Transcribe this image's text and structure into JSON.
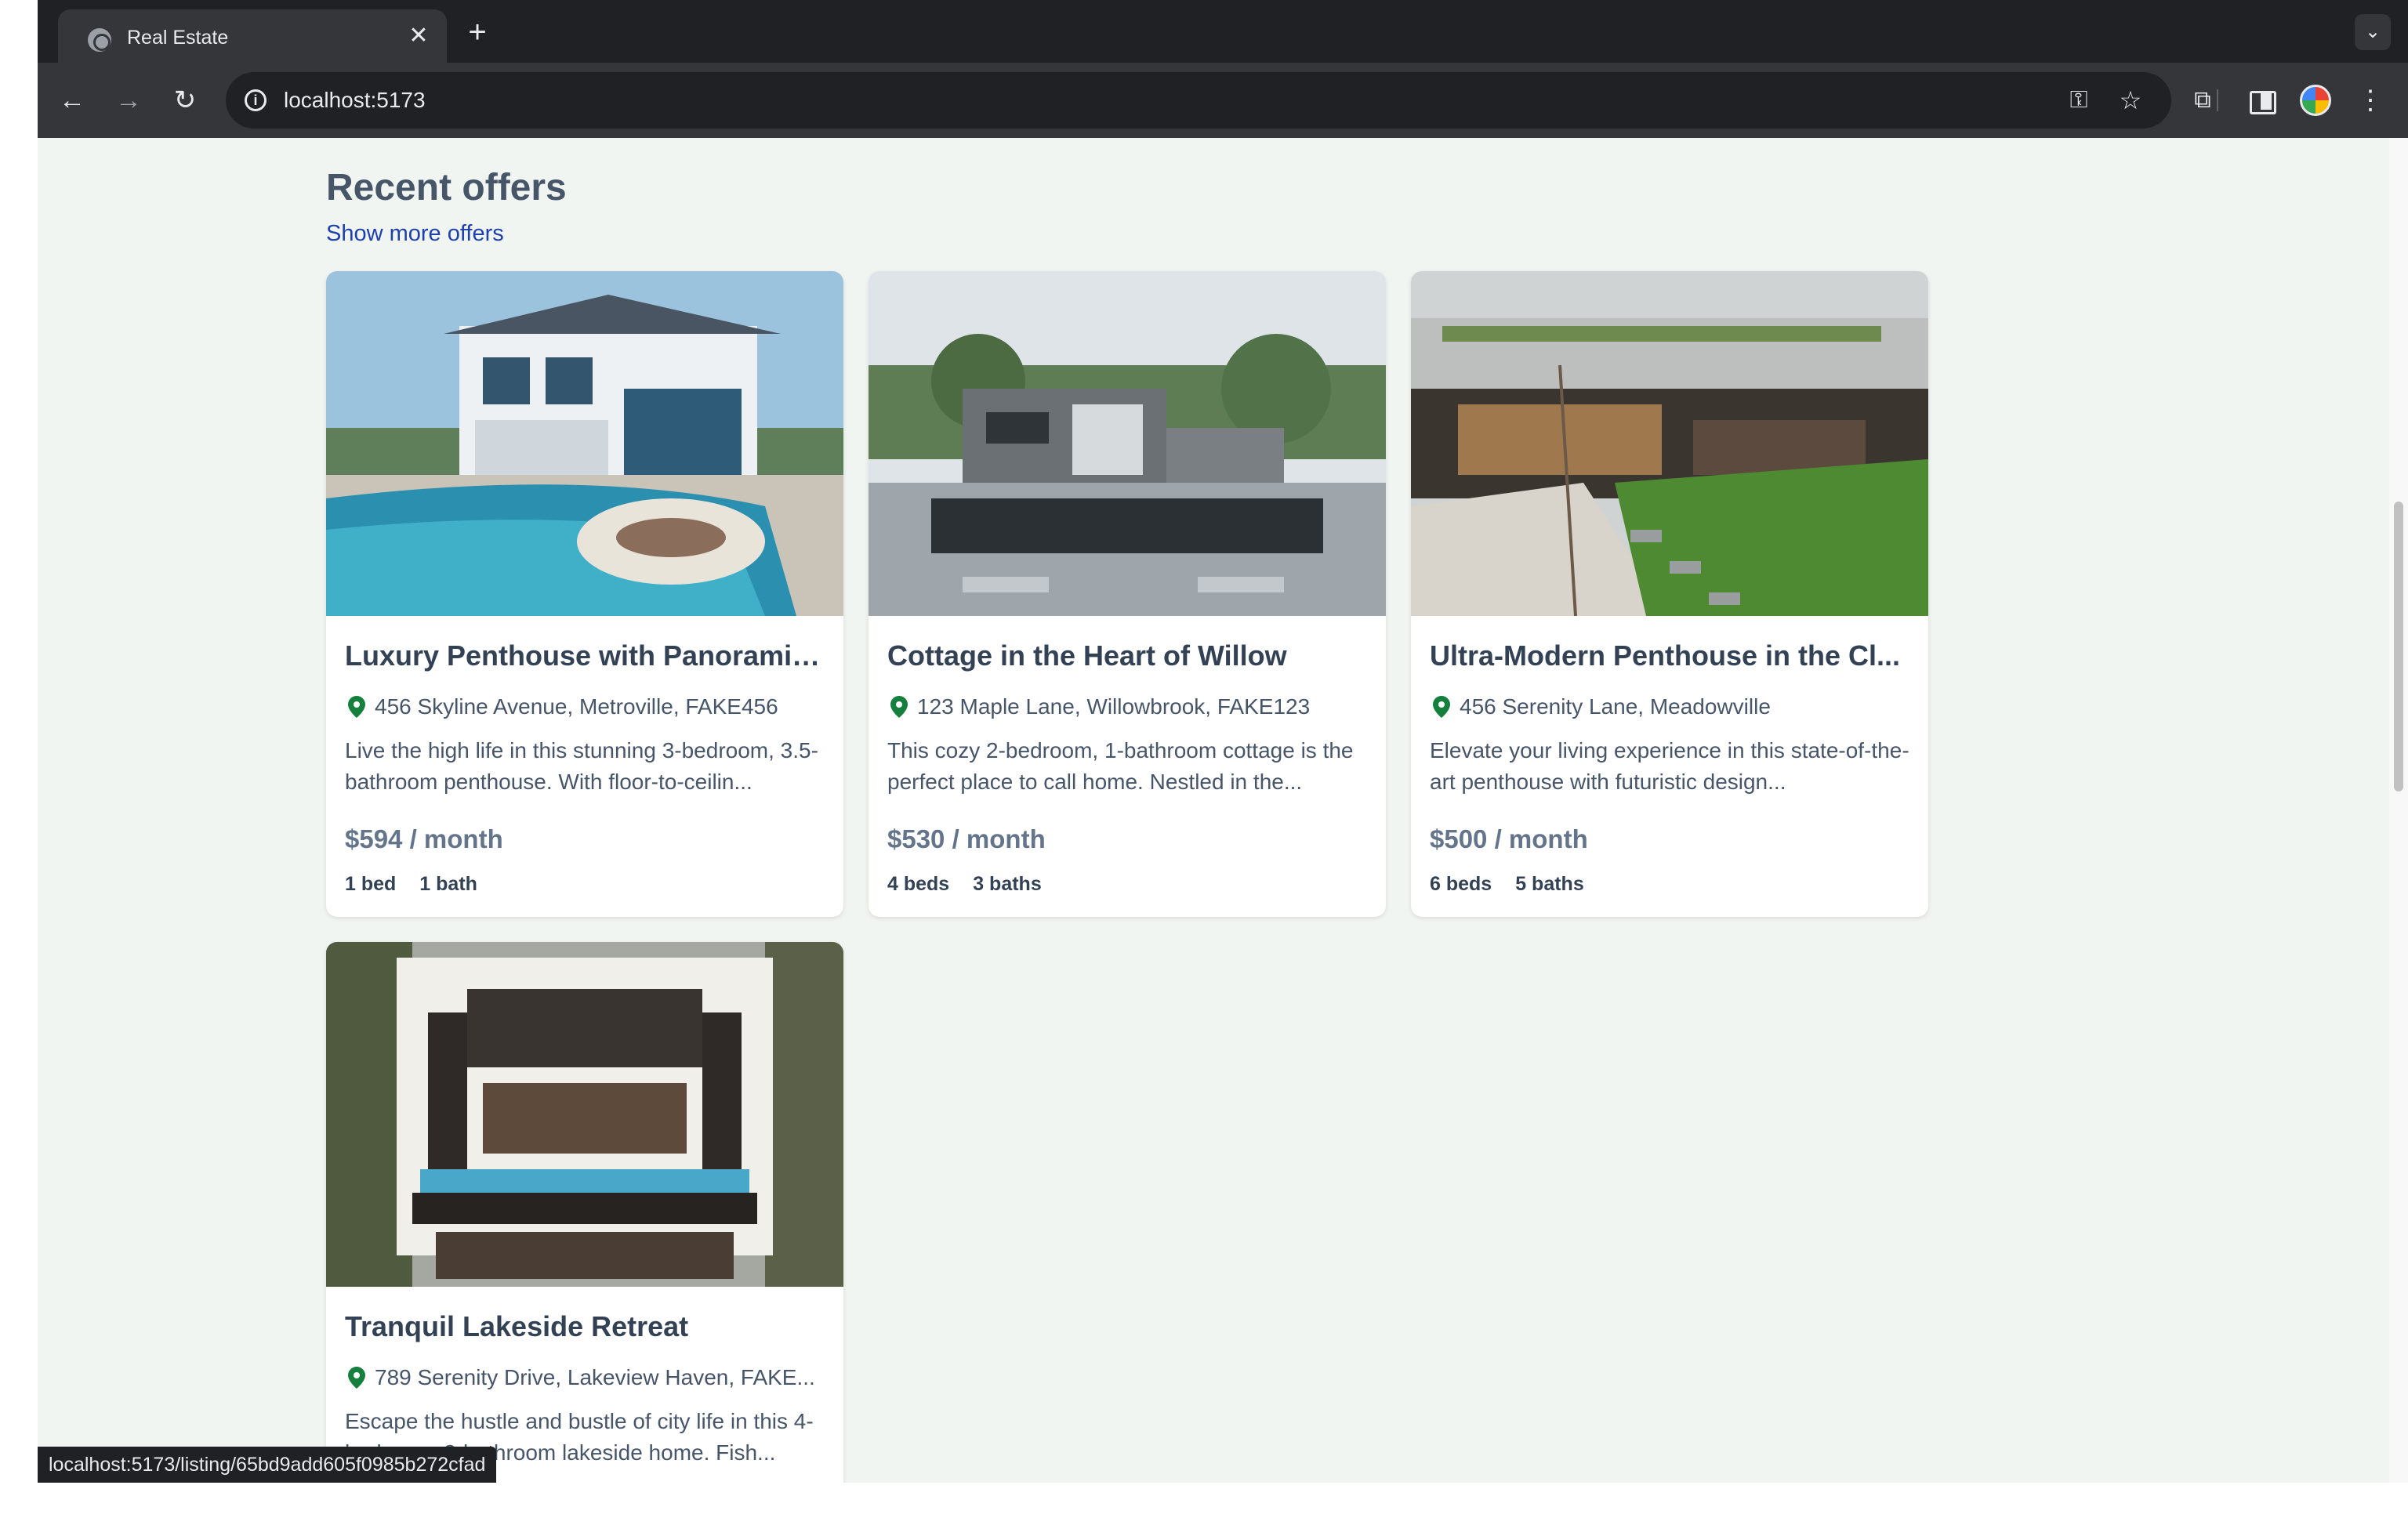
{
  "browser": {
    "tab_title": "Real Estate",
    "url": "localhost:5173",
    "status_url": "localhost:5173/listing/65bd9add605f0985b272cfad"
  },
  "section": {
    "title": "Recent offers",
    "more_link": "Show more offers"
  },
  "listings": [
    {
      "title": "Luxury Penthouse with Panoramic ...",
      "address": "456 Skyline Avenue, Metroville, FAKE456",
      "description": "Live the high life in this stunning 3-bedroom, 3.5-bathroom penthouse. With floor-to-ceilin...",
      "price": "$594 / month",
      "beds": "1 bed",
      "baths": "1 bath"
    },
    {
      "title": "Cottage in the Heart of Willow",
      "address": "123 Maple Lane, Willowbrook, FAKE123",
      "description": "This cozy 2-bedroom, 1-bathroom cottage is the perfect place to call home. Nestled in the...",
      "price": "$530 / month",
      "beds": "4 beds",
      "baths": "3 baths"
    },
    {
      "title": "Ultra-Modern Penthouse in the Cl...",
      "address": "456 Serenity Lane, Meadowville",
      "description": "Elevate your living experience in this state-of-the-art penthouse with futuristic design...",
      "price": "$500 / month",
      "beds": "6 beds",
      "baths": "5 baths"
    },
    {
      "title": "Tranquil Lakeside Retreat",
      "address": "789 Serenity Drive, Lakeview Haven, FAKE...",
      "description": "Escape the hustle and bustle of city life in this 4-bedroom, 3-bathroom lakeside home. Fish...",
      "price": "",
      "beds": "",
      "baths": ""
    }
  ],
  "colors": {
    "page_bg": "#f1f5f1",
    "link": "#1e40af",
    "pin": "#15803d"
  }
}
